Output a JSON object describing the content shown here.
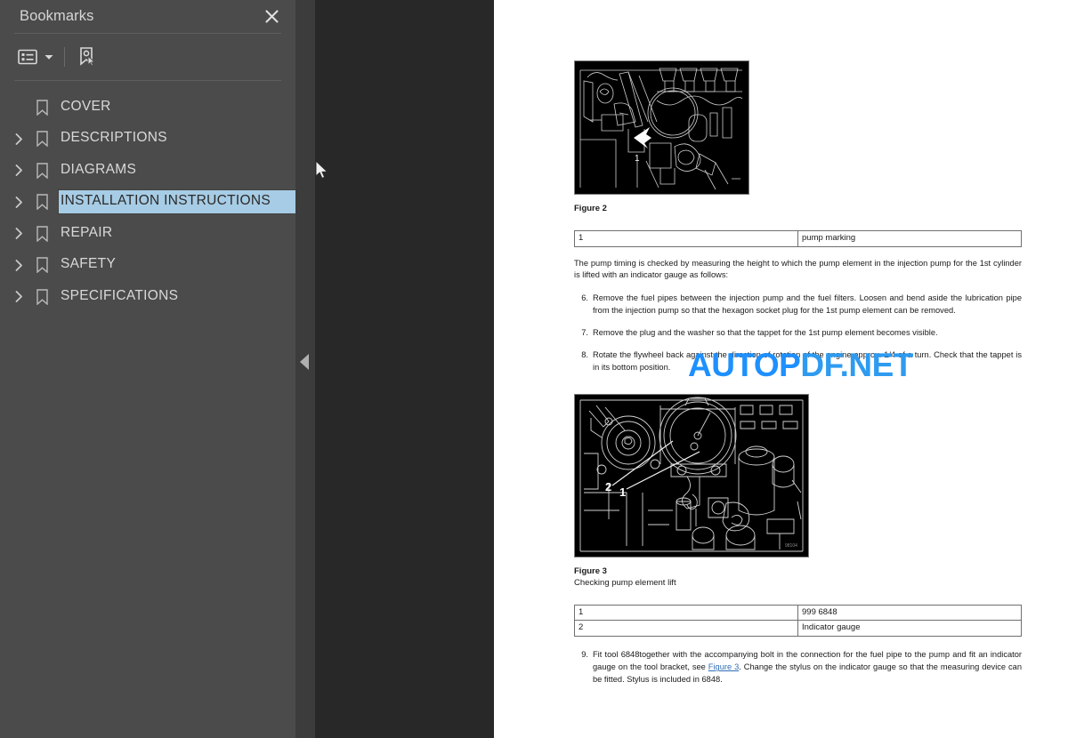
{
  "sidebar": {
    "title": "Bookmarks",
    "close_icon": "close-icon",
    "toolbar": {
      "options_icon": "list-options-icon",
      "caret_icon": "chevron-down-icon",
      "new_bookmark_icon": "new-bookmark-icon"
    },
    "items": [
      {
        "label": "COVER",
        "expandable": false,
        "selected": false
      },
      {
        "label": "DESCRIPTIONS",
        "expandable": true,
        "selected": false
      },
      {
        "label": "DIAGRAMS",
        "expandable": true,
        "selected": false
      },
      {
        "label": "INSTALLATION INSTRUCTIONS",
        "expandable": true,
        "selected": true
      },
      {
        "label": "REPAIR",
        "expandable": true,
        "selected": false
      },
      {
        "label": "SAFETY",
        "expandable": true,
        "selected": false
      },
      {
        "label": "SPECIFICATIONS",
        "expandable": true,
        "selected": false
      }
    ]
  },
  "panel_handle": {
    "icon": "collapse-panel-triangle-icon"
  },
  "document": {
    "figure2": {
      "caption": "Figure 2",
      "callout": "1",
      "table": {
        "rows": [
          {
            "key": "1",
            "value": "pump marking"
          }
        ]
      }
    },
    "intro_paragraph": "The pump timing is checked by measuring the height to which the pump element in the injection pump for the 1st cylinder is lifted with an indicator gauge as follows:",
    "steps": [
      {
        "num": "6.",
        "text": "Remove the fuel pipes between the injection pump and the fuel filters. Loosen and bend aside the lubrication pipe from the injection pump so that the hexagon socket plug for the 1st pump element can be removed."
      },
      {
        "num": "7.",
        "text": "Remove the plug and the washer so that the tappet for the 1st pump element becomes visible."
      },
      {
        "num": "8.",
        "text": "Rotate the flywheel back against the direction of rotation of the engine approx. 1/4 of a turn. Check that the tappet is in its bottom position."
      }
    ],
    "figure3": {
      "caption": "Figure 3",
      "subcaption": "Checking pump element lift",
      "callouts": [
        "2",
        "1"
      ],
      "table": {
        "rows": [
          {
            "key": "1",
            "value": "999 6848"
          },
          {
            "key": "2",
            "value": "Indicator gauge"
          }
        ]
      }
    },
    "final_step": {
      "num": "9.",
      "text_before": "Fit tool 6848together with the accompanying bolt in the connection for the fuel pipe to the pump and fit an indicator gauge on the tool bracket, see ",
      "link": "Figure 3",
      "text_after": ". Change the stylus on the indicator gauge so that the measuring device can be fitted. Stylus is included in 6848."
    }
  },
  "watermark": {
    "part1": "AUTOP",
    "part2": "DF.NET"
  },
  "colors": {
    "sidebar_bg": "#4b4b4b",
    "viewer_bg": "#282828",
    "page_bg": "#ffffff",
    "selection": "#a7cce5",
    "watermark": "#1e90ff"
  }
}
